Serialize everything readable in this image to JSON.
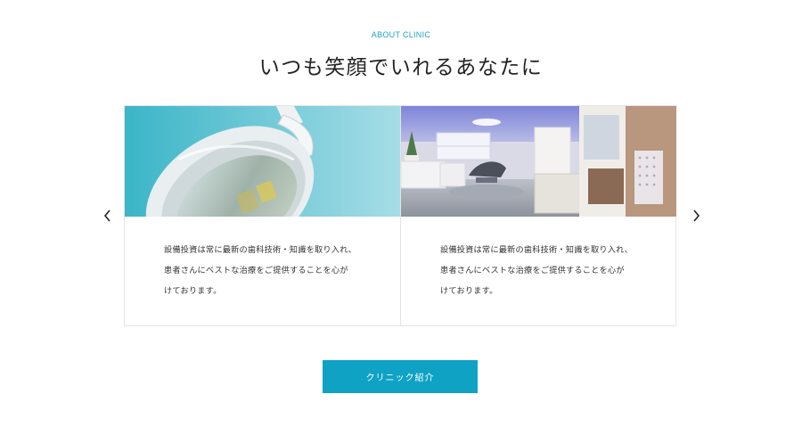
{
  "section": {
    "eyebrow": "ABOUT CLINIC",
    "title": "いつも笑顔でいれるあなたに"
  },
  "cards": [
    {
      "image_subject": "dental-lamp-photo",
      "lines": [
        "設備投資は常に最新の歯科技術・知識を取り入れ、",
        "患者さんにベストな治療をご提供することを心が",
        "けております。"
      ]
    },
    {
      "image_subject": "clinic-room-photo",
      "lines": [
        "設備投資は常に最新の歯科技術・知識を取り入れ、",
        "患者さんにベストな治療をご提供することを心が",
        "けております。"
      ]
    }
  ],
  "controls": {
    "prev_icon": "chevron-left-icon",
    "next_icon": "chevron-right-icon"
  },
  "cta": {
    "label": "クリニック紹介"
  },
  "colors": {
    "accent": "#0fa2c4",
    "eyebrow": "#1aa3c3"
  }
}
